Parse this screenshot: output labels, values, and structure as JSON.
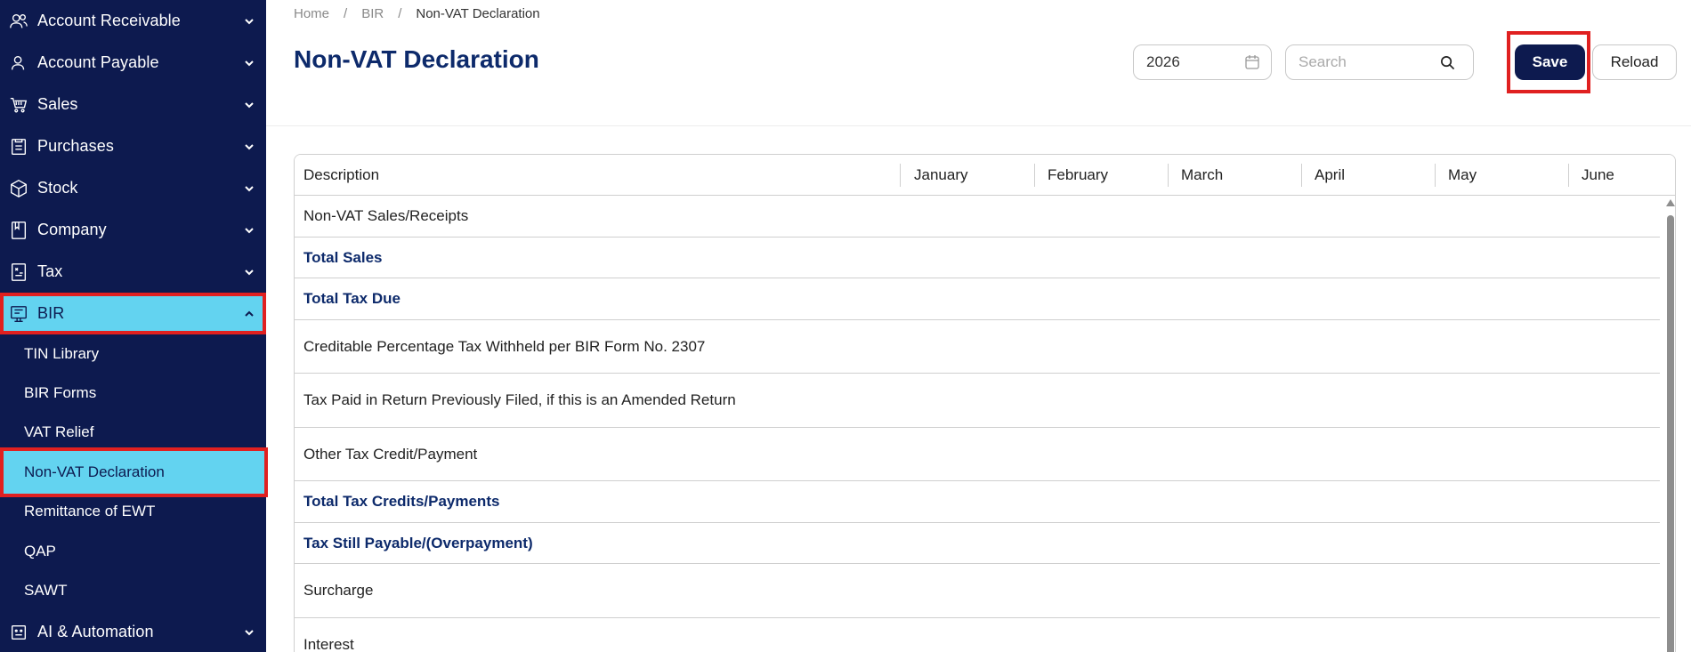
{
  "sidebar": {
    "items": [
      {
        "label": "Account Receivable",
        "icon": "users-icon"
      },
      {
        "label": "Account Payable",
        "icon": "user-icon"
      },
      {
        "label": "Sales",
        "icon": "cart-icon"
      },
      {
        "label": "Purchases",
        "icon": "clipboard-icon"
      },
      {
        "label": "Stock",
        "icon": "box-icon"
      },
      {
        "label": "Company",
        "icon": "bookmark-icon"
      },
      {
        "label": "Tax",
        "icon": "tax-icon"
      },
      {
        "label": "BIR",
        "icon": "bir-icon"
      }
    ],
    "bir_subitems": [
      {
        "label": "TIN Library"
      },
      {
        "label": "BIR Forms"
      },
      {
        "label": "VAT Relief"
      },
      {
        "label": "Non-VAT Declaration"
      },
      {
        "label": "Remittance of EWT"
      },
      {
        "label": "QAP"
      },
      {
        "label": "SAWT"
      }
    ],
    "last_item": {
      "label": "AI & Automation",
      "icon": "robot-icon"
    }
  },
  "breadcrumb": {
    "home": "Home",
    "section": "BIR",
    "current": "Non-VAT Declaration"
  },
  "page_title": "Non-VAT Declaration",
  "toolbar": {
    "year_value": "2026",
    "search_placeholder": "Search",
    "save_label": "Save",
    "reload_label": "Reload"
  },
  "table": {
    "columns": [
      "Description",
      "January",
      "February",
      "March",
      "April",
      "May",
      "June"
    ],
    "rows": [
      {
        "label": "Non-VAT Sales/Receipts",
        "bold": false
      },
      {
        "label": "Total Sales",
        "bold": true
      },
      {
        "label": "Total Tax Due",
        "bold": true
      },
      {
        "label": "Creditable Percentage Tax Withheld per BIR Form No. 2307",
        "bold": false
      },
      {
        "label": "Tax Paid in Return Previously Filed, if this is an Amended Return",
        "bold": false
      },
      {
        "label": "Other Tax Credit/Payment",
        "bold": false
      },
      {
        "label": "Total Tax Credits/Payments",
        "bold": true
      },
      {
        "label": "Tax Still Payable/(Overpayment)",
        "bold": true
      },
      {
        "label": "Surcharge",
        "bold": false
      },
      {
        "label": "Interest",
        "bold": false
      }
    ]
  },
  "colors": {
    "sidebar_bg": "#0d1a4f",
    "active_bg": "#63d3f0",
    "highlight_border": "#e02020",
    "title_color": "#0d2a6b"
  }
}
